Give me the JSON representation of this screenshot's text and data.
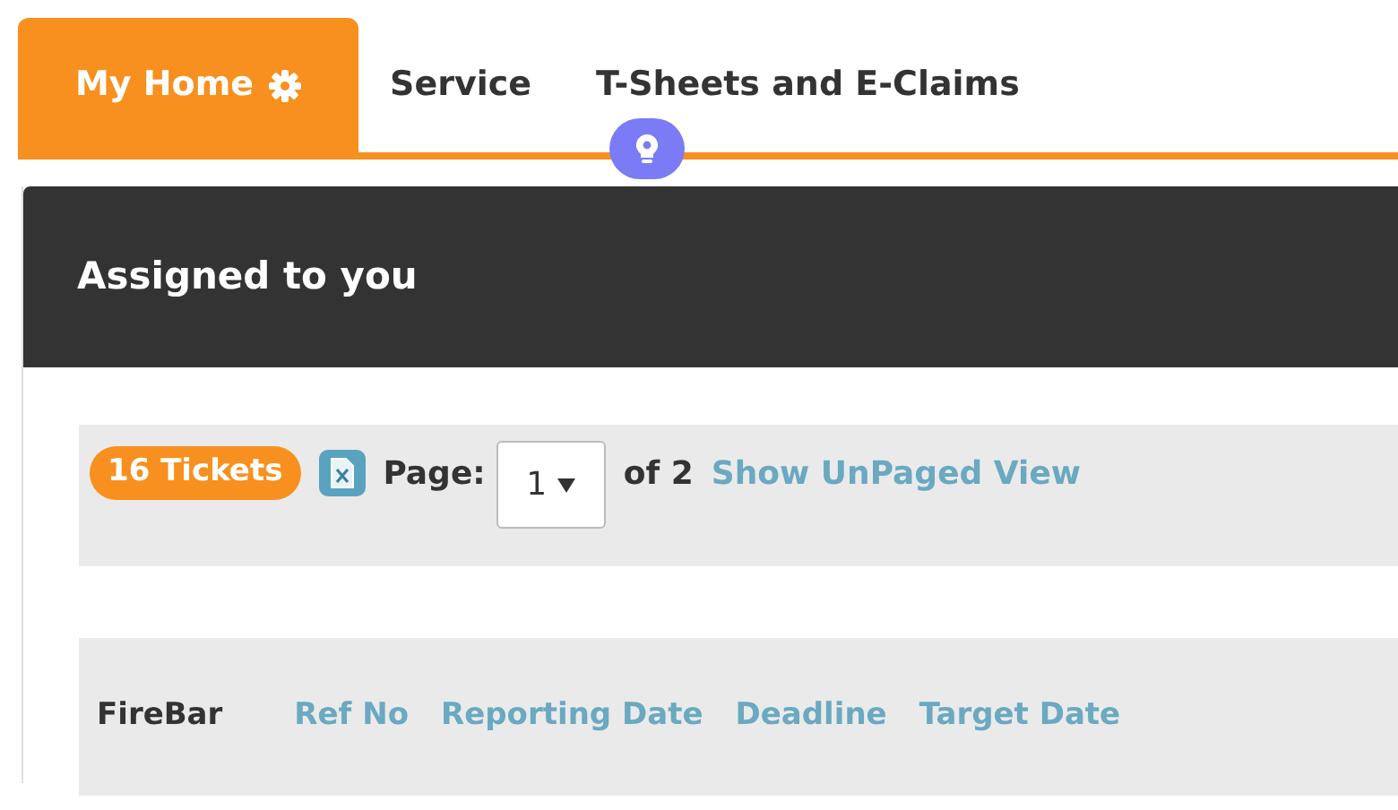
{
  "tabs": [
    {
      "label": "My Home",
      "selected": true,
      "has_settings": true
    },
    {
      "label": "Service",
      "selected": false,
      "has_settings": false
    },
    {
      "label": "T-Sheets and E-Claims",
      "selected": false,
      "has_settings": false
    }
  ],
  "panel": {
    "title": "Assigned to you"
  },
  "toolbar": {
    "ticket_count": "16 Tickets",
    "page_label": "Page:",
    "page_value": "1",
    "page_total": "of 2",
    "unpaged_link": "Show UnPaged View"
  },
  "table": {
    "columns": [
      {
        "label": "FireBar",
        "sortable": false
      },
      {
        "label": "Ref No",
        "sortable": true
      },
      {
        "label": "Reporting Date",
        "sortable": true
      },
      {
        "label": "Deadline",
        "sortable": true
      },
      {
        "label": "Target Date",
        "sortable": true
      }
    ]
  }
}
